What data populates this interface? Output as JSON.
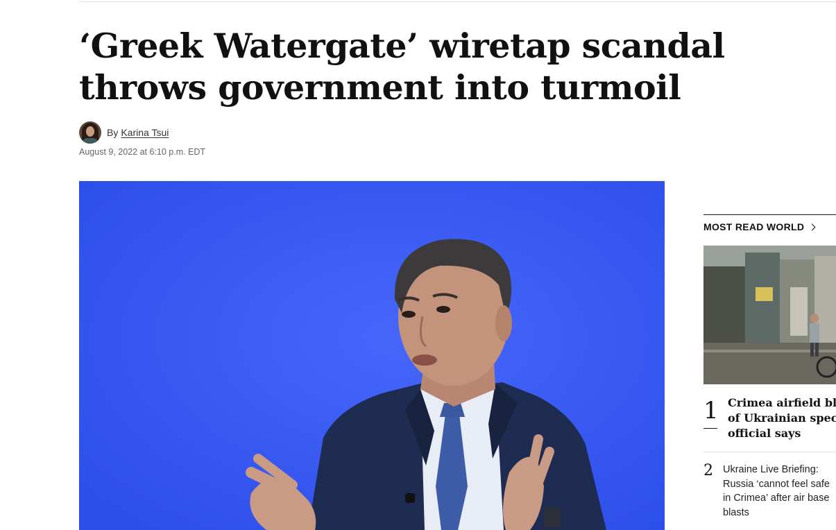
{
  "article": {
    "headline": "‘Greek Watergate’ wiretap scandal throws government into turmoil",
    "byline_prefix": "By",
    "author": "Karina Tsui",
    "timestamp": "August 9, 2022 at 6:10 p.m. EDT"
  },
  "sidebar": {
    "section_title": "MOST READ WORLD",
    "stories": [
      {
        "rank": "1",
        "lines": [
          "Crimea airfield bla",
          "of Ukrainian specia",
          "official says"
        ]
      },
      {
        "rank": "2",
        "lines": [
          "Ukraine Live Briefing:",
          "Russia ‘cannot feel safe",
          "in Crimea’ after air base",
          "blasts"
        ]
      }
    ]
  },
  "colors": {
    "hero_background": "#3355f2",
    "text": "#111111",
    "meta_text": "#666666"
  },
  "icons": [
    "chevron-right-icon"
  ]
}
